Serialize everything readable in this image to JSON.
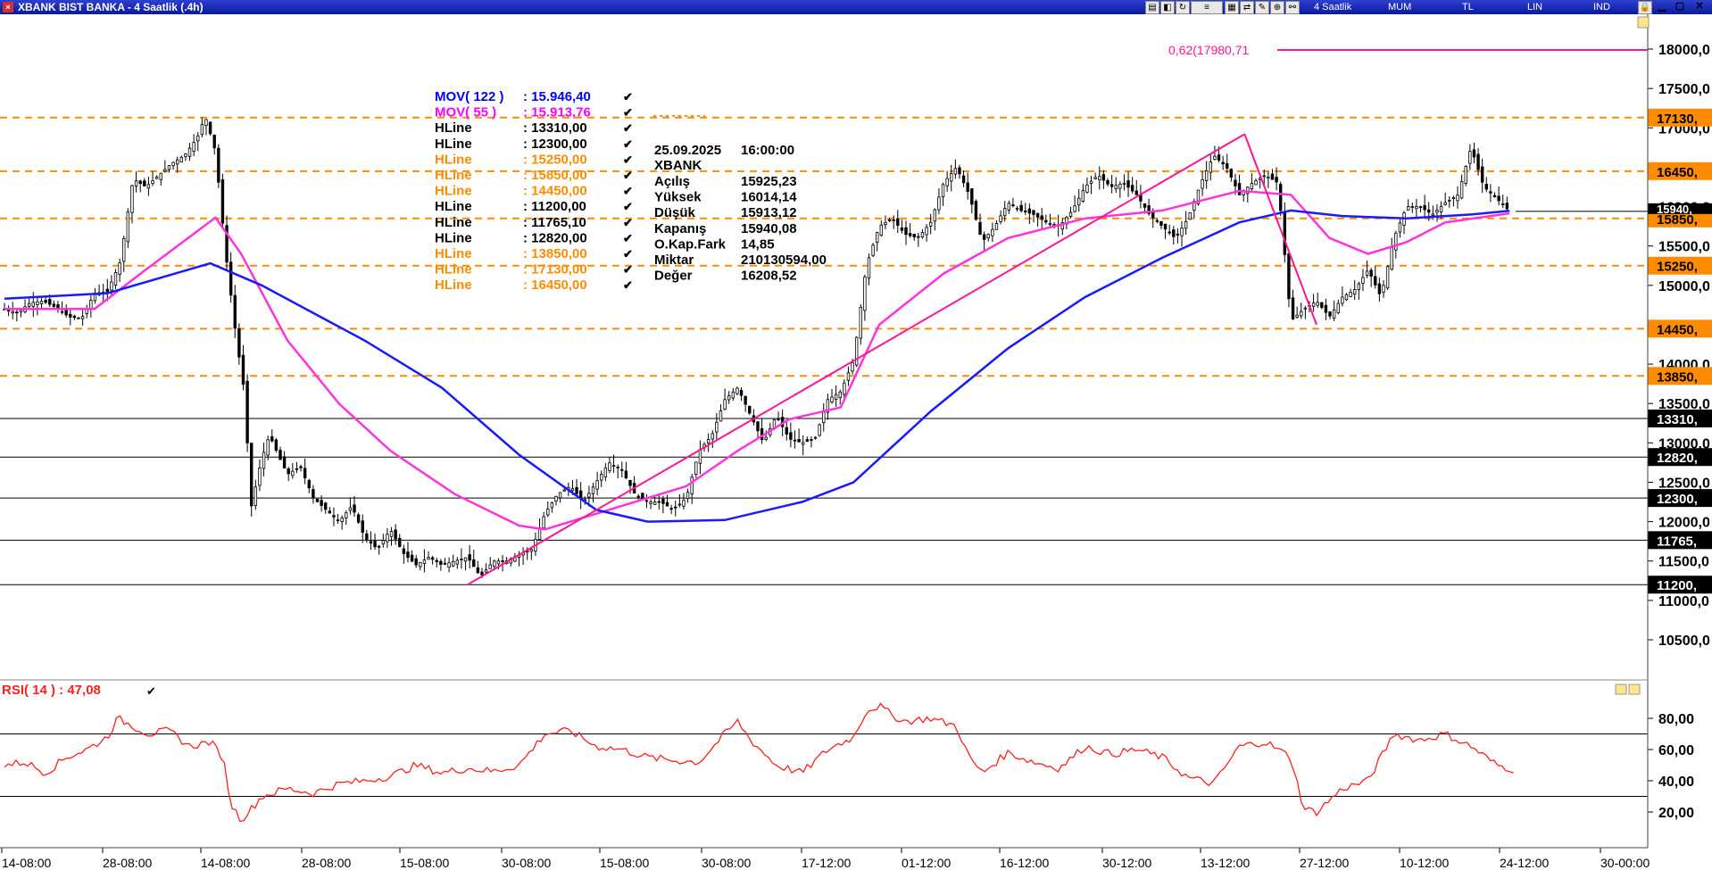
{
  "window": {
    "title": "XBANK BIST BANKA - 4 Saatlik (.4h)",
    "period": "4 Saatlik",
    "style": "MUM",
    "currency": "TL",
    "scale": "LIN",
    "index": "IND"
  },
  "legend": [
    {
      "label": "MOV( 122 )",
      "value": ": 15.946,40",
      "color": "#0000ff"
    },
    {
      "label": "MOV( 55 )",
      "value": ": 15.913,76",
      "color": "#ff00ff"
    },
    {
      "label": "HLine",
      "value": ": 13310,00",
      "color": "#000000"
    },
    {
      "label": "HLine",
      "value": ": 12300,00",
      "color": "#000000"
    },
    {
      "label": "HLine",
      "value": ": 15250,00",
      "color": "#ff8c00"
    },
    {
      "label": "HLine",
      "value": ": 15850,00",
      "color": "#ff8c00"
    },
    {
      "label": "HLine",
      "value": ": 14450,00",
      "color": "#ff8c00"
    },
    {
      "label": "HLine",
      "value": ": 11200,00",
      "color": "#000000"
    },
    {
      "label": "HLine",
      "value": ": 11765,10",
      "color": "#000000"
    },
    {
      "label": "HLine",
      "value": ": 12820,00",
      "color": "#000000"
    },
    {
      "label": "HLine",
      "value": ": 13850,00",
      "color": "#ff8c00"
    },
    {
      "label": "HLine",
      "value": ": 17130,00",
      "color": "#ff8c00"
    },
    {
      "label": "HLine",
      "value": ": 16450,00",
      "color": "#ff8c00"
    }
  ],
  "info": {
    "date": "25.09.2025",
    "time": "16:00:00",
    "symbol": "XBANK",
    "rows": [
      {
        "k": "Açılış",
        "v": "15925,23"
      },
      {
        "k": "Yüksek",
        "v": "16014,14"
      },
      {
        "k": "Düşük",
        "v": "15913,12"
      },
      {
        "k": "Kapanış",
        "v": "15940,08"
      },
      {
        "k": "O.Kap.Fark",
        "v": "14,85"
      },
      {
        "k": "Miktar",
        "v": "210130594,00"
      },
      {
        "k": "Değer",
        "v": "16208,52"
      }
    ]
  },
  "fib_label": "0,62(17980,71",
  "rsi_label": "RSI( 14 )   : 47,08",
  "price_tags": [
    "17130,",
    "16450,",
    "15850,",
    "15250,",
    "14450,",
    "13850,",
    "13310,",
    "12820,",
    "12300,",
    "11765,",
    "11200,"
  ],
  "current_tag": "15940,",
  "colors": {
    "mov122": "#1a1aff",
    "mov55": "#ff33dd",
    "orange": "#ff8c00",
    "trend": "#ff1493",
    "rsi": "#ff2020"
  },
  "chart_data": [
    {
      "type": "candlestick",
      "title": "XBANK BIST BANKA - 4 Saatlik (.4h)",
      "y_axis_ticks": [
        "18000,0",
        "17500,0",
        "17000,0",
        "16500,0",
        "16000,0",
        "15500,0",
        "15000,0",
        "14500,0",
        "14000,0",
        "13500,0",
        "13000,0",
        "12500,0",
        "12000,0",
        "11500,0",
        "11000,0",
        "10500,0"
      ],
      "x_axis_ticks": [
        "14-08:00",
        "28-08:00",
        "14-08:00",
        "28-08:00",
        "15-08:00",
        "30-08:00",
        "15-08:00",
        "30-08:00",
        "17-12:00",
        "01-12:00",
        "16-12:00",
        "30-12:00",
        "13-12:00",
        "27-12:00",
        "10-12:00",
        "24-12:00",
        "30-00:00"
      ],
      "ylim": [
        10200,
        18300
      ],
      "hlines": [
        {
          "value": 17130,
          "style": "dashed",
          "color": "orange"
        },
        {
          "value": 16450,
          "style": "dashed",
          "color": "orange"
        },
        {
          "value": 15850,
          "style": "dashed",
          "color": "orange"
        },
        {
          "value": 15250,
          "style": "dashed",
          "color": "orange"
        },
        {
          "value": 14450,
          "style": "dashed",
          "color": "orange"
        },
        {
          "value": 13850,
          "style": "dashed",
          "color": "orange"
        },
        {
          "value": 13310,
          "style": "solid",
          "color": "black"
        },
        {
          "value": 12820,
          "style": "solid",
          "color": "black"
        },
        {
          "value": 12300,
          "style": "solid",
          "color": "black"
        },
        {
          "value": 11765.1,
          "style": "solid",
          "color": "black"
        },
        {
          "value": 11200,
          "style": "solid",
          "color": "black"
        }
      ],
      "fib_level": 17980.71,
      "close_series": [
        [
          0,
          14700
        ],
        [
          5,
          14650
        ],
        [
          10,
          14780
        ],
        [
          15,
          14800
        ],
        [
          20,
          14720
        ],
        [
          25,
          14600
        ],
        [
          30,
          14580
        ],
        [
          35,
          14900
        ],
        [
          40,
          14920
        ],
        [
          45,
          15300
        ],
        [
          50,
          16350
        ],
        [
          55,
          16250
        ],
        [
          60,
          16400
        ],
        [
          65,
          16550
        ],
        [
          70,
          16650
        ],
        [
          75,
          16880
        ],
        [
          78,
          17150
        ],
        [
          82,
          16700
        ],
        [
          86,
          15400
        ],
        [
          90,
          14350
        ],
        [
          93,
          13700
        ],
        [
          96,
          12200
        ],
        [
          100,
          12800
        ],
        [
          103,
          13100
        ],
        [
          107,
          12800
        ],
        [
          110,
          12600
        ],
        [
          115,
          12700
        ],
        [
          120,
          12300
        ],
        [
          125,
          12150
        ],
        [
          130,
          12000
        ],
        [
          135,
          12200
        ],
        [
          140,
          11800
        ],
        [
          145,
          11650
        ],
        [
          150,
          11900
        ],
        [
          155,
          11600
        ],
        [
          160,
          11450
        ],
        [
          165,
          11550
        ],
        [
          170,
          11450
        ],
        [
          175,
          11500
        ],
        [
          180,
          11550
        ],
        [
          185,
          11300
        ],
        [
          190,
          11500
        ],
        [
          195,
          11500
        ],
        [
          200,
          11580
        ],
        [
          205,
          11650
        ],
        [
          210,
          12100
        ],
        [
          215,
          12350
        ],
        [
          220,
          12450
        ],
        [
          225,
          12250
        ],
        [
          230,
          12500
        ],
        [
          235,
          12750
        ],
        [
          240,
          12650
        ],
        [
          245,
          12350
        ],
        [
          250,
          12250
        ],
        [
          255,
          12250
        ],
        [
          260,
          12150
        ],
        [
          265,
          12300
        ],
        [
          270,
          12900
        ],
        [
          275,
          13100
        ],
        [
          280,
          13550
        ],
        [
          285,
          13700
        ],
        [
          290,
          13350
        ],
        [
          295,
          13000
        ],
        [
          300,
          13350
        ],
        [
          305,
          13050
        ],
        [
          310,
          13000
        ],
        [
          315,
          13050
        ],
        [
          320,
          13550
        ],
        [
          325,
          13650
        ],
        [
          330,
          14050
        ],
        [
          335,
          15250
        ],
        [
          340,
          15750
        ],
        [
          345,
          15850
        ],
        [
          350,
          15650
        ],
        [
          355,
          15600
        ],
        [
          360,
          15800
        ],
        [
          365,
          16300
        ],
        [
          370,
          16500
        ],
        [
          375,
          16150
        ],
        [
          380,
          15550
        ],
        [
          385,
          15750
        ],
        [
          390,
          16050
        ],
        [
          395,
          15950
        ],
        [
          400,
          15900
        ],
        [
          405,
          15800
        ],
        [
          410,
          15750
        ],
        [
          415,
          15950
        ],
        [
          420,
          16250
        ],
        [
          425,
          16400
        ],
        [
          430,
          16250
        ],
        [
          435,
          16300
        ],
        [
          440,
          16150
        ],
        [
          445,
          15900
        ],
        [
          450,
          15750
        ],
        [
          455,
          15600
        ],
        [
          460,
          15850
        ],
        [
          465,
          16300
        ],
        [
          470,
          16650
        ],
        [
          475,
          16500
        ],
        [
          480,
          16150
        ],
        [
          485,
          16300
        ],
        [
          490,
          16400
        ],
        [
          495,
          16300
        ],
        [
          500,
          14550
        ],
        [
          505,
          14700
        ],
        [
          510,
          14800
        ],
        [
          515,
          14600
        ],
        [
          520,
          14850
        ],
        [
          525,
          14950
        ],
        [
          530,
          15200
        ],
        [
          535,
          14850
        ],
        [
          540,
          15600
        ],
        [
          545,
          16000
        ],
        [
          550,
          16000
        ],
        [
          555,
          15900
        ],
        [
          560,
          16050
        ],
        [
          565,
          16150
        ],
        [
          570,
          16750
        ],
        [
          575,
          16250
        ],
        [
          580,
          16100
        ],
        [
          585,
          15940
        ]
      ],
      "mov122_series": [
        [
          0,
          14830
        ],
        [
          40,
          14900
        ],
        [
          80,
          15280
        ],
        [
          100,
          15000
        ],
        [
          140,
          14300
        ],
        [
          170,
          13700
        ],
        [
          200,
          12850
        ],
        [
          230,
          12150
        ],
        [
          250,
          12000
        ],
        [
          280,
          12020
        ],
        [
          310,
          12250
        ],
        [
          330,
          12500
        ],
        [
          360,
          13400
        ],
        [
          390,
          14200
        ],
        [
          420,
          14850
        ],
        [
          450,
          15350
        ],
        [
          480,
          15800
        ],
        [
          500,
          15950
        ],
        [
          520,
          15880
        ],
        [
          545,
          15850
        ],
        [
          570,
          15900
        ],
        [
          585,
          15946
        ]
      ],
      "mov55_series": [
        [
          0,
          14700
        ],
        [
          35,
          14700
        ],
        [
          55,
          15200
        ],
        [
          82,
          15860
        ],
        [
          92,
          15400
        ],
        [
          110,
          14300
        ],
        [
          130,
          13500
        ],
        [
          150,
          12900
        ],
        [
          175,
          12350
        ],
        [
          200,
          11950
        ],
        [
          210,
          11900
        ],
        [
          240,
          12200
        ],
        [
          265,
          12450
        ],
        [
          285,
          12900
        ],
        [
          305,
          13300
        ],
        [
          325,
          13450
        ],
        [
          340,
          14500
        ],
        [
          365,
          15150
        ],
        [
          390,
          15600
        ],
        [
          420,
          15850
        ],
        [
          450,
          15950
        ],
        [
          480,
          16200
        ],
        [
          500,
          16150
        ],
        [
          515,
          15600
        ],
        [
          530,
          15400
        ],
        [
          545,
          15550
        ],
        [
          560,
          15800
        ],
        [
          585,
          15914
        ]
      ],
      "trendlines": [
        [
          [
            180,
            11200
          ],
          [
            482,
            16920
          ]
        ],
        [
          [
            482,
            16920
          ],
          [
            510,
            14500
          ]
        ]
      ]
    },
    {
      "type": "line",
      "title": "RSI( 14 )",
      "y_axis_ticks": [
        "80,00",
        "60,00",
        "40,00",
        "20,00"
      ],
      "ylim": [
        4,
        96
      ],
      "hlines": [
        70,
        30
      ],
      "series": [
        [
          0,
          50
        ],
        [
          8,
          52
        ],
        [
          16,
          45
        ],
        [
          24,
          55
        ],
        [
          32,
          60
        ],
        [
          40,
          68
        ],
        [
          44,
          80
        ],
        [
          50,
          75
        ],
        [
          56,
          70
        ],
        [
          64,
          72
        ],
        [
          72,
          62
        ],
        [
          80,
          65
        ],
        [
          85,
          55
        ],
        [
          88,
          25
        ],
        [
          92,
          15
        ],
        [
          96,
          22
        ],
        [
          100,
          30
        ],
        [
          110,
          35
        ],
        [
          120,
          32
        ],
        [
          130,
          38
        ],
        [
          140,
          40
        ],
        [
          150,
          43
        ],
        [
          160,
          50
        ],
        [
          170,
          45
        ],
        [
          180,
          48
        ],
        [
          190,
          46
        ],
        [
          200,
          50
        ],
        [
          210,
          70
        ],
        [
          220,
          72
        ],
        [
          230,
          62
        ],
        [
          240,
          60
        ],
        [
          250,
          55
        ],
        [
          260,
          53
        ],
        [
          270,
          52
        ],
        [
          280,
          70
        ],
        [
          285,
          78
        ],
        [
          290,
          66
        ],
        [
          300,
          50
        ],
        [
          310,
          45
        ],
        [
          320,
          60
        ],
        [
          330,
          68
        ],
        [
          335,
          85
        ],
        [
          340,
          88
        ],
        [
          345,
          82
        ],
        [
          350,
          78
        ],
        [
          360,
          80
        ],
        [
          370,
          75
        ],
        [
          375,
          55
        ],
        [
          380,
          45
        ],
        [
          390,
          58
        ],
        [
          400,
          52
        ],
        [
          410,
          48
        ],
        [
          420,
          62
        ],
        [
          430,
          57
        ],
        [
          440,
          60
        ],
        [
          450,
          55
        ],
        [
          460,
          42
        ],
        [
          470,
          38
        ],
        [
          480,
          62
        ],
        [
          490,
          65
        ],
        [
          500,
          55
        ],
        [
          505,
          22
        ],
        [
          510,
          20
        ],
        [
          520,
          35
        ],
        [
          530,
          40
        ],
        [
          540,
          70
        ],
        [
          550,
          66
        ],
        [
          560,
          70
        ],
        [
          570,
          62
        ],
        [
          580,
          50
        ],
        [
          587,
          47
        ]
      ]
    }
  ]
}
